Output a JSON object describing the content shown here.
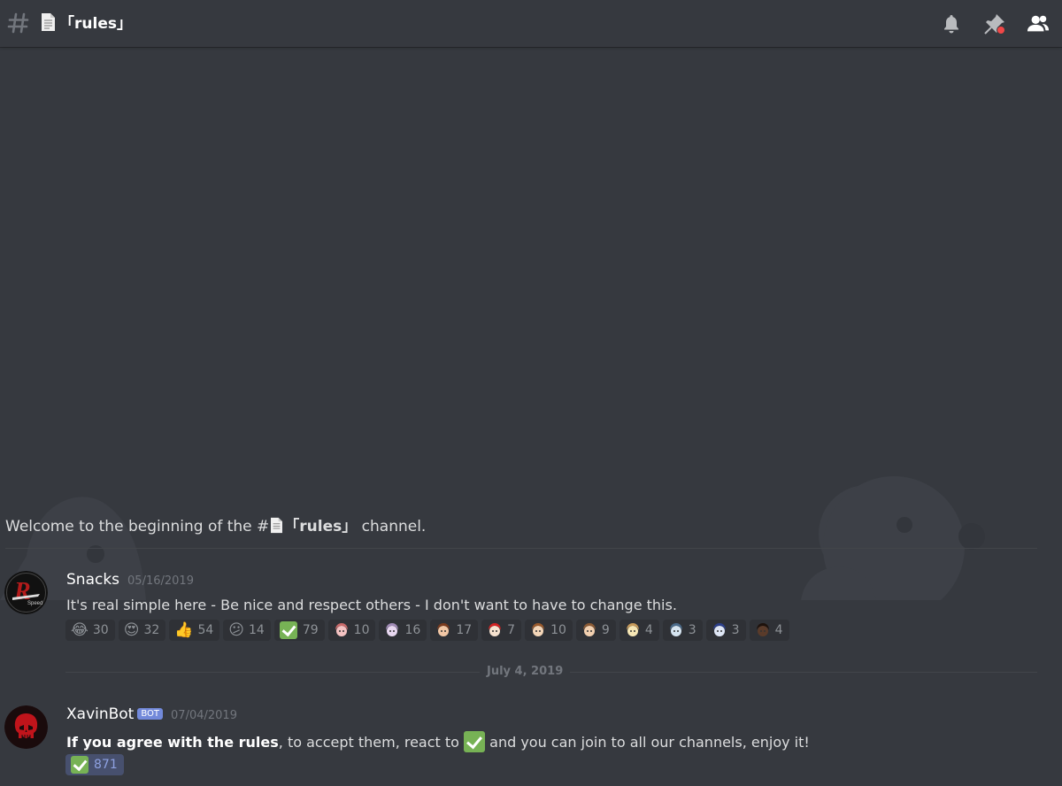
{
  "channel": {
    "name": "「rules」",
    "doc_icon": "page-icon"
  },
  "header_icons": [
    "bell-icon",
    "pin-icon",
    "members-icon"
  ],
  "welcome": {
    "prefix": "Welcome to the beginning of the #",
    "channel": "「rules」",
    "suffix": " channel."
  },
  "messages": [
    {
      "username": "Snacks",
      "timestamp": "05/16/2019",
      "text": "It's real simple here - Be nice and respect others - I don't want to have to change this.",
      "reactions": [
        {
          "emoji": "😂",
          "count": "30"
        },
        {
          "emoji": "😍",
          "count": "32"
        },
        {
          "emoji": "👍",
          "count": "54"
        },
        {
          "emoji": "😕",
          "count": "14"
        },
        {
          "emoji": "check",
          "count": "79"
        },
        {
          "emoji": "custom-1",
          "count": "10"
        },
        {
          "emoji": "custom-2",
          "count": "16"
        },
        {
          "emoji": "custom-3",
          "count": "17"
        },
        {
          "emoji": "custom-4",
          "count": "7"
        },
        {
          "emoji": "custom-5",
          "count": "10"
        },
        {
          "emoji": "custom-6",
          "count": "9"
        },
        {
          "emoji": "custom-7",
          "count": "4"
        },
        {
          "emoji": "custom-8",
          "count": "3"
        },
        {
          "emoji": "custom-9",
          "count": "3"
        },
        {
          "emoji": "custom-10",
          "count": "4"
        }
      ]
    },
    {
      "username": "XavinBot",
      "bot_tag": "BOT",
      "timestamp": "07/04/2019",
      "text_bold": "If you agree with the rules",
      "text_mid": ", to accept them, react to ",
      "text_end": " and you can join to all our channels, enjoy it!",
      "reactions": [
        {
          "emoji": "check",
          "count": "871"
        }
      ]
    }
  ],
  "date_separator": "July 4, 2019",
  "colors": {
    "bg": "#36393f",
    "accent": "#7289da",
    "check": "#77b255",
    "notify_dot": "#f04747"
  }
}
